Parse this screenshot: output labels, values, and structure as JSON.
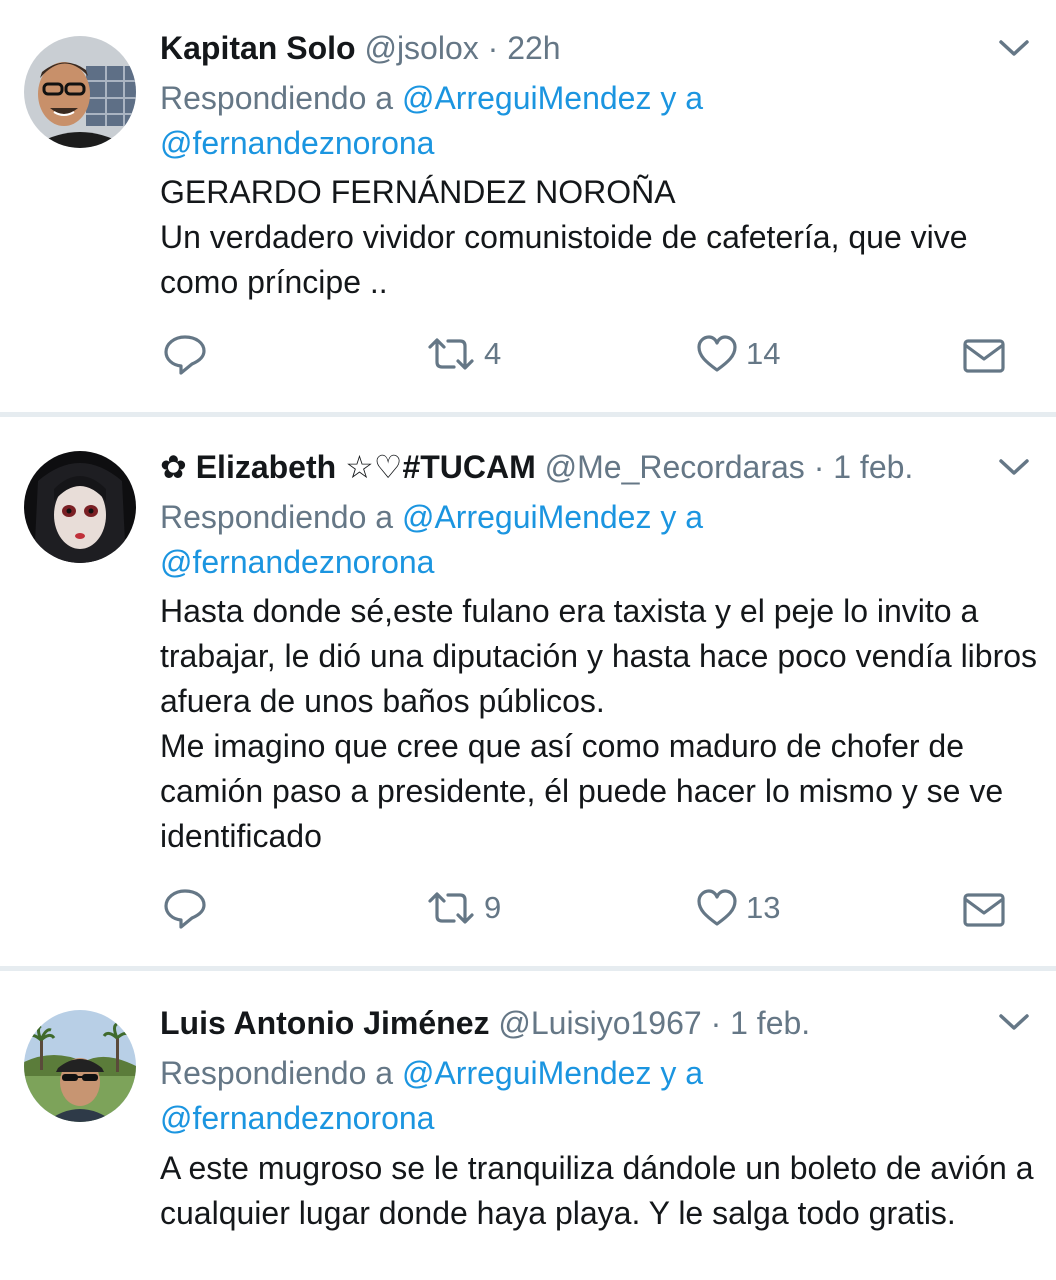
{
  "colors": {
    "link": "#1b95e0",
    "muted": "#657786",
    "text": "#14171a",
    "divider": "#e6ecf0"
  },
  "tweets": [
    {
      "name": "Kapitan Solo",
      "handle": "@jsolox",
      "separator": "·",
      "time": "22h",
      "reply_prefix": "Respondiendo a",
      "reply_user1": "@ArreguiMendez",
      "reply_and": "y a",
      "reply_user2": "@fernandeznorona",
      "lines": [
        "GERARDO FERNÁNDEZ NOROÑA",
        "Un verdadero vividor comunistoide de cafetería, que vive como príncipe .."
      ],
      "retweets": "4",
      "likes": "14",
      "icons": [
        "reply-icon",
        "retweet-icon",
        "heart-icon",
        "mail-icon",
        "chevron-down-icon"
      ]
    },
    {
      "name": "✿ Elizabeth ☆♡#TUCAM",
      "handle": "@Me_Recordaras",
      "separator": "·",
      "time": "1 feb.",
      "reply_prefix": "Respondiendo a",
      "reply_user1": "@ArreguiMendez",
      "reply_and": "y a",
      "reply_user2": "@fernandeznorona",
      "lines": [
        "Hasta donde sé,este fulano era taxista y el peje lo invito a trabajar, le dió una diputación y hasta hace poco vendía libros afuera de unos baños públicos.",
        "Me imagino que cree que así como maduro de chofer de camión paso a presidente, él puede hacer lo mismo y se ve identificado"
      ],
      "retweets": "9",
      "likes": "13",
      "icons": [
        "reply-icon",
        "retweet-icon",
        "heart-icon",
        "mail-icon",
        "chevron-down-icon"
      ]
    },
    {
      "name": "Luis Antonio Jiménez",
      "handle": "@Luisiyo1967",
      "separator": "·",
      "time": "1 feb.",
      "reply_prefix": "Respondiendo a",
      "reply_user1": "@ArreguiMendez",
      "reply_and": "y a",
      "reply_user2": "@fernandeznorona",
      "lines": [
        "A este mugroso se le tranquiliza dándole un boleto de avión a cualquier lugar donde haya playa. Y le salga todo gratis."
      ],
      "icons": [
        "chevron-down-icon"
      ]
    }
  ]
}
